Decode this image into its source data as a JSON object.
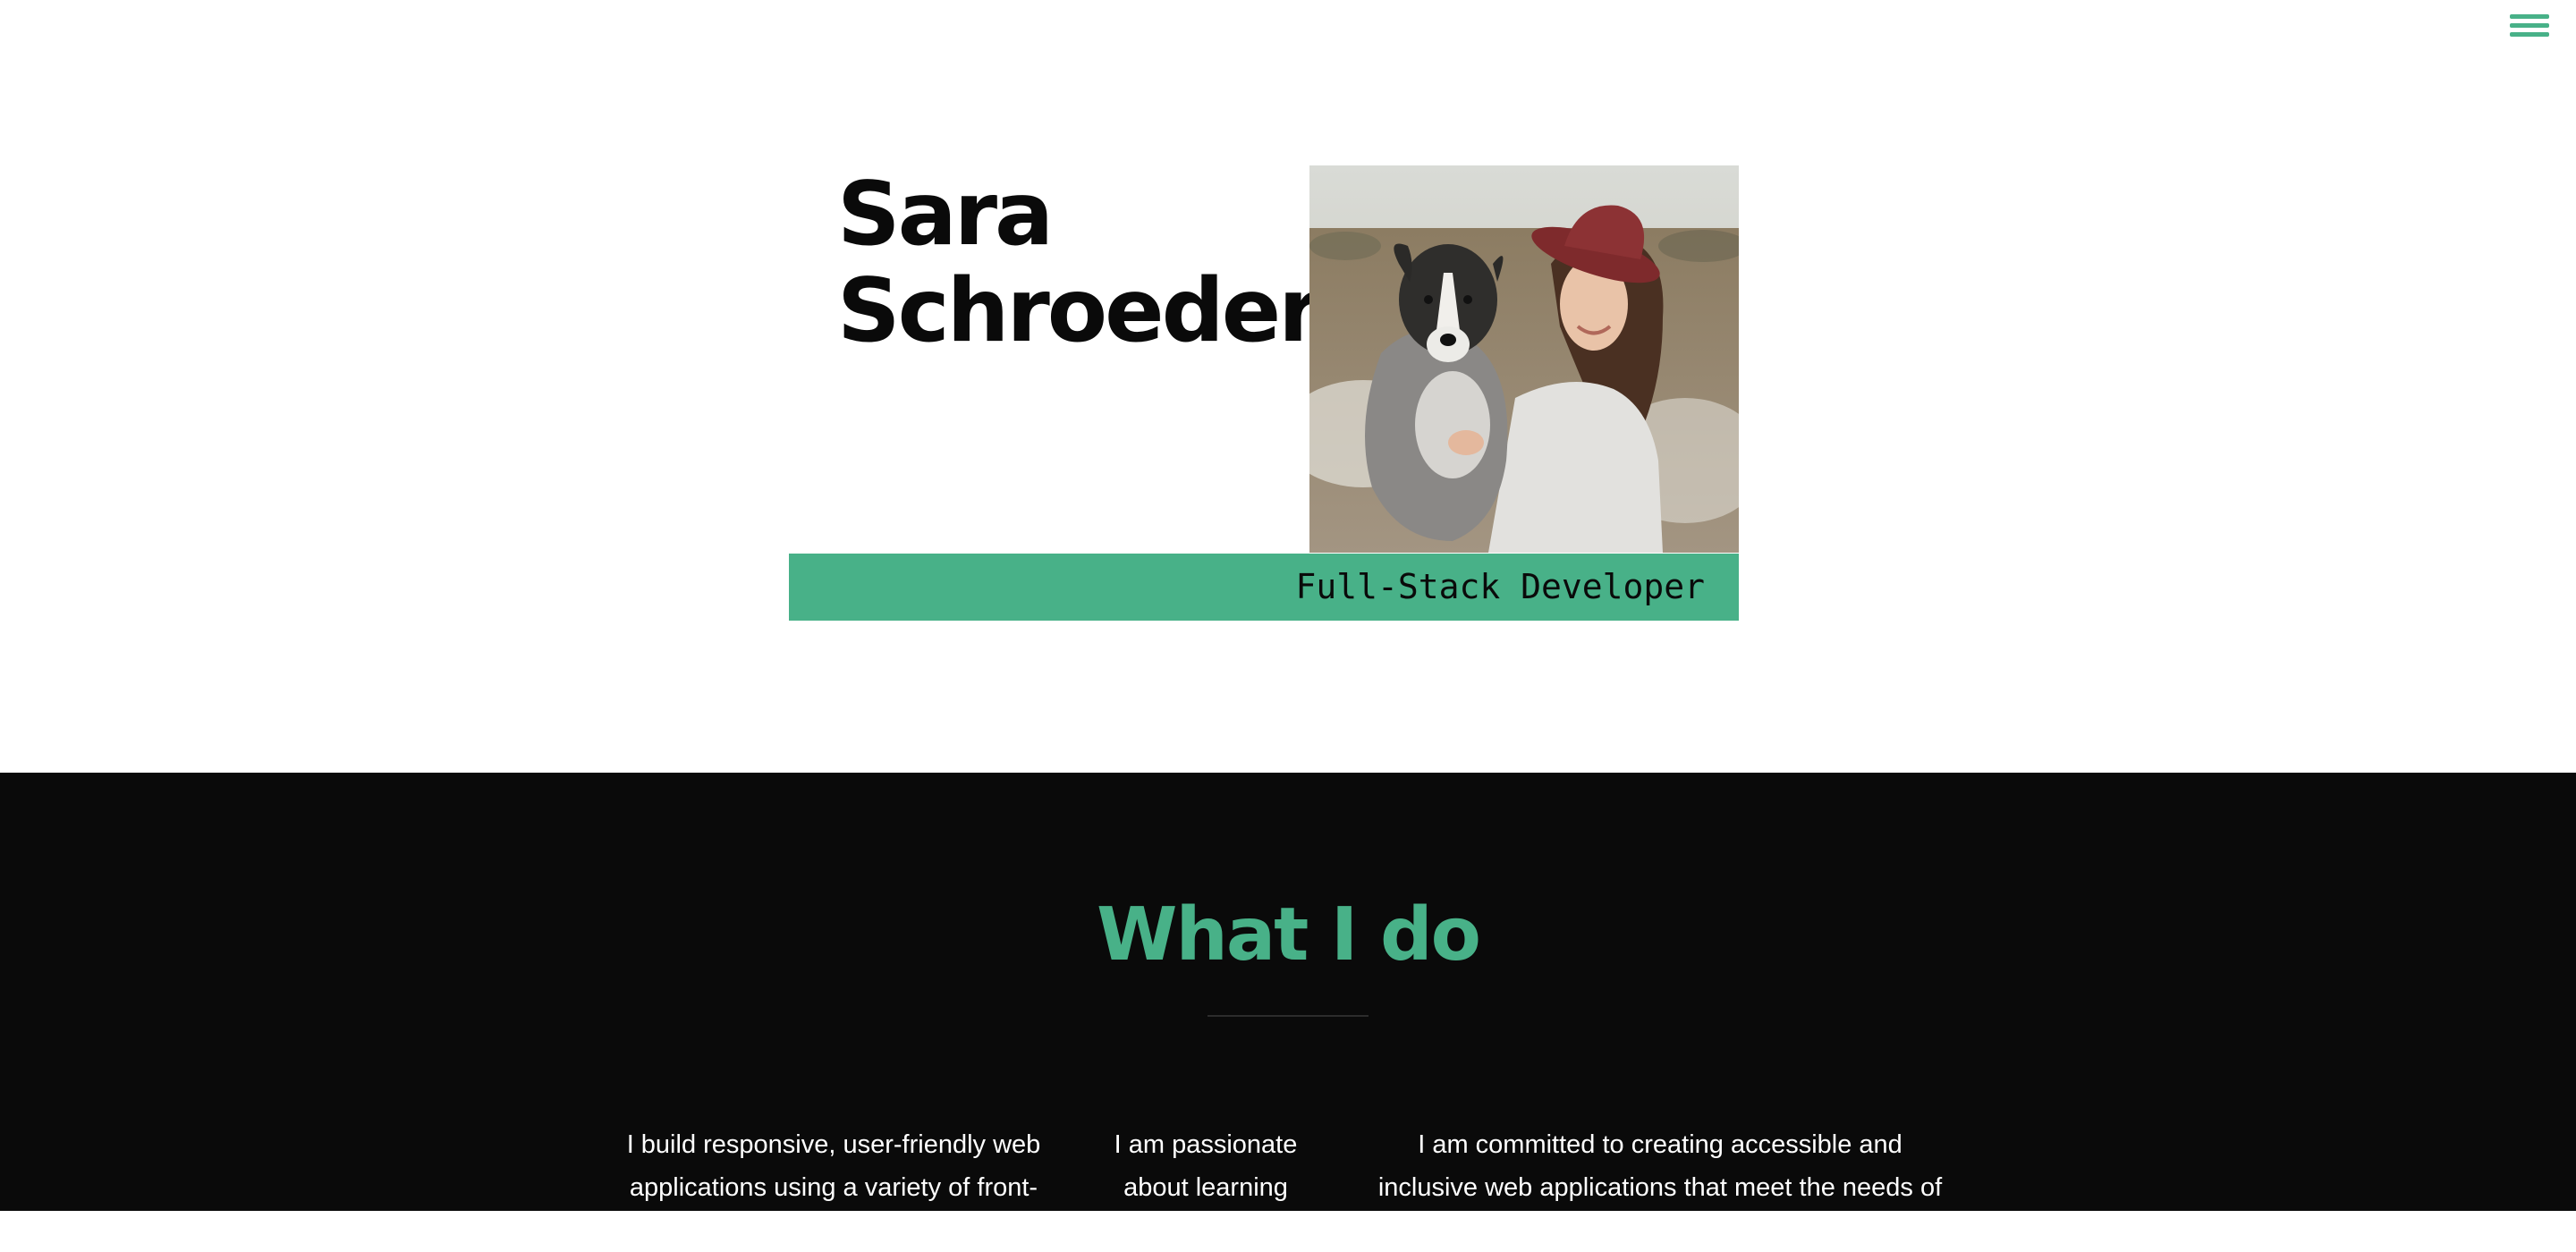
{
  "nav": {
    "menu_icon": "hamburger-menu-icon",
    "accent_color": "#48b188"
  },
  "hero": {
    "first_name": "Sara",
    "last_name": "Schroeder",
    "role": "Full-Stack Developer",
    "photo_subject": "woman-with-dog-photo"
  },
  "what_i_do": {
    "title": "What I do",
    "columns": [
      {
        "text": "I build responsive, user-friendly web applications using a variety of front-end"
      },
      {
        "text": "I am passionate about learning"
      },
      {
        "text": "I am committed to creating accessible and inclusive web applications that meet the needs of all users. I"
      }
    ]
  },
  "colors": {
    "accent": "#48b188",
    "dark_background": "#0a0a0a",
    "text_dark": "#0a0a0a",
    "text_light": "#ffffff"
  }
}
